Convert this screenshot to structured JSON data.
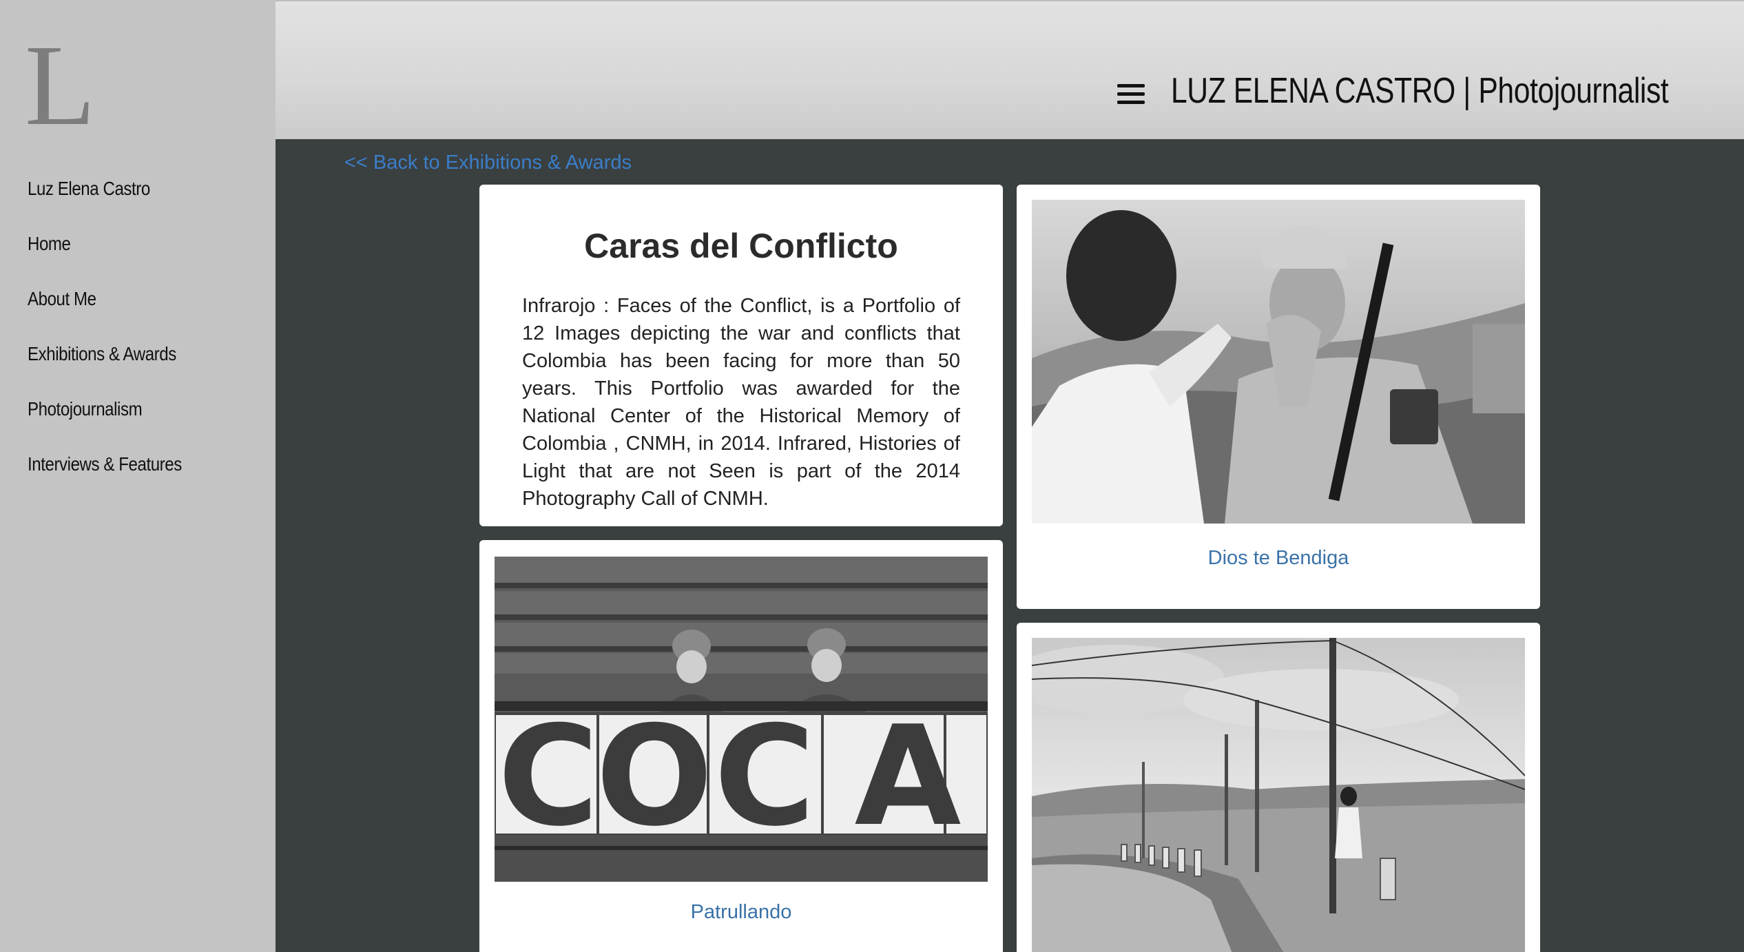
{
  "sidebar": {
    "logo_letter": "L",
    "items": [
      {
        "label": "Luz Elena Castro"
      },
      {
        "label": "Home"
      },
      {
        "label": "About Me"
      },
      {
        "label": "Exhibitions & Awards"
      },
      {
        "label": "Photojournalism"
      },
      {
        "label": "Interviews & Features"
      }
    ]
  },
  "header": {
    "menu_icon": "hamburger-icon",
    "title": "LUZ ELENA CASTRO | Photojournalist"
  },
  "main": {
    "back_link": "<< Back to Exhibitions & Awards",
    "intro": {
      "title": "Caras del Conflicto",
      "text": "Infrarojo : Faces of the Conflict, is a Portfolio of 12 Images depicting the war and conflicts that Colombia has been facing for more than 50 years. This Portfolio was awarded for the National Center of the Historical Memory of Colombia , CNMH, in 2014. Infrared, Histories of Light that are not Seen is part of the 2014 Photography Call of CNMH."
    },
    "photos": [
      {
        "caption": "Dios te Bendiga"
      },
      {
        "caption": "Patrullando",
        "sign_letters": [
          "C",
          "O",
          "C",
          "A"
        ]
      },
      {
        "caption": ""
      }
    ]
  },
  "colors": {
    "sidebar_bg": "#c4c4c4",
    "main_bg": "#3a3f40",
    "link": "#3a7ec8",
    "caption": "#3a72a8"
  }
}
